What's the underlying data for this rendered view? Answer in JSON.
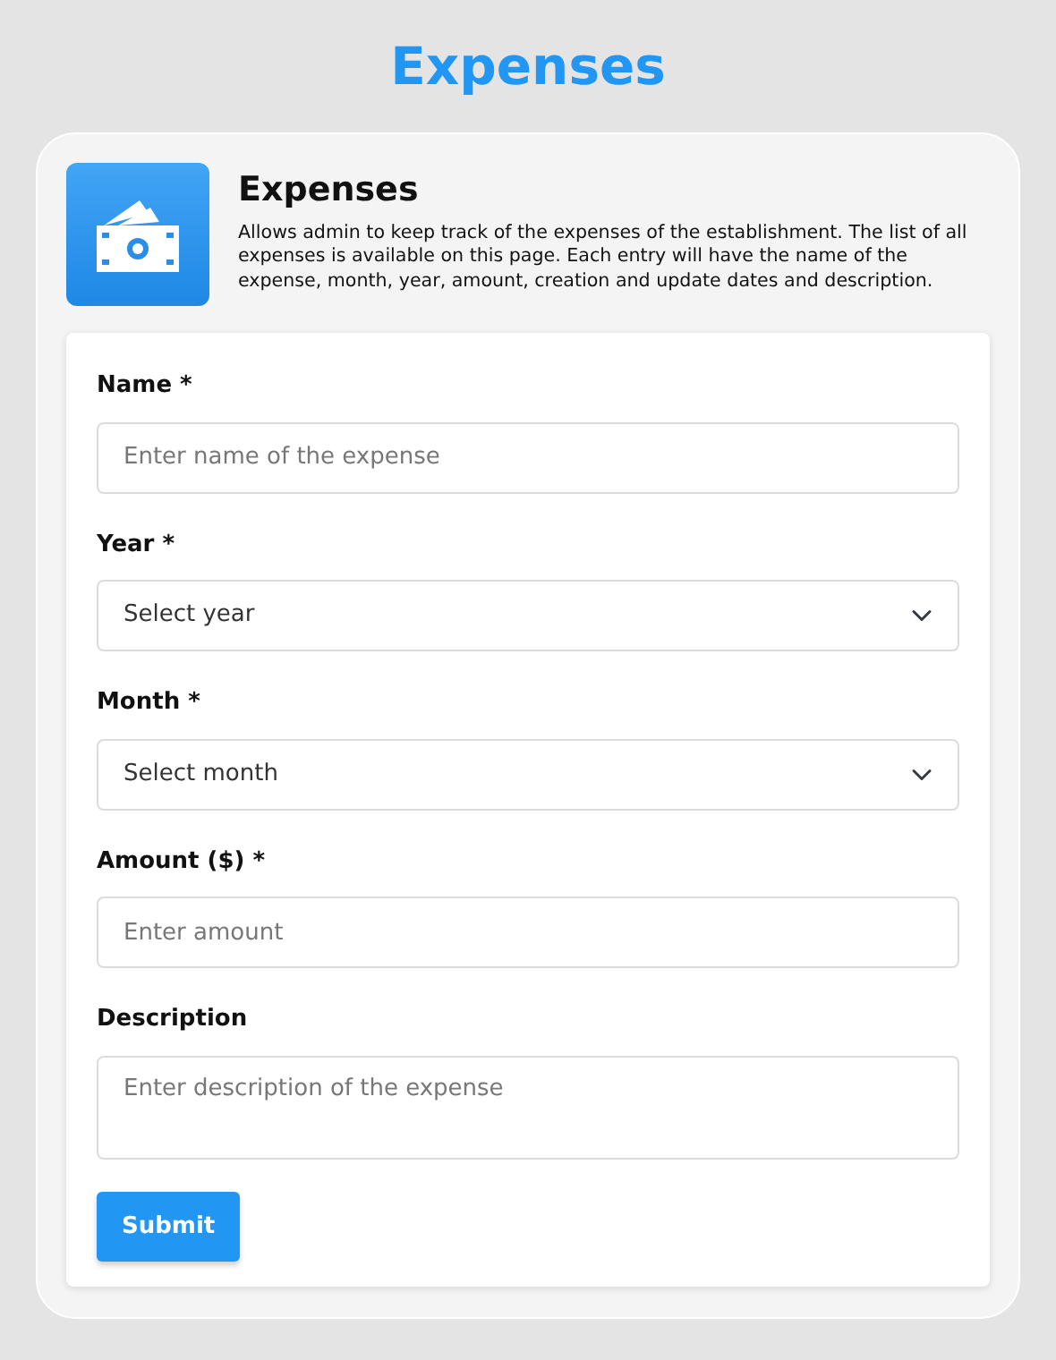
{
  "page_title": "Expenses",
  "header": {
    "title": "Expenses",
    "description": "Allows admin to keep track of the expenses of the establishment. The list of all expenses is available on this page. Each entry will have the name of the expense, month, year, amount, creation and update dates and description."
  },
  "fields": [
    {
      "kind": "text",
      "label": "Name *",
      "placeholder": "Enter name of the expense"
    },
    {
      "kind": "select",
      "label": "Year *",
      "placeholder": "Select year"
    },
    {
      "kind": "select",
      "label": "Month *",
      "placeholder": "Select month"
    },
    {
      "kind": "text",
      "label": "Amount ($) *",
      "placeholder": "Enter amount"
    },
    {
      "kind": "textarea",
      "label": "Description",
      "placeholder": "Enter description of the expense"
    }
  ],
  "submit": "Submit"
}
